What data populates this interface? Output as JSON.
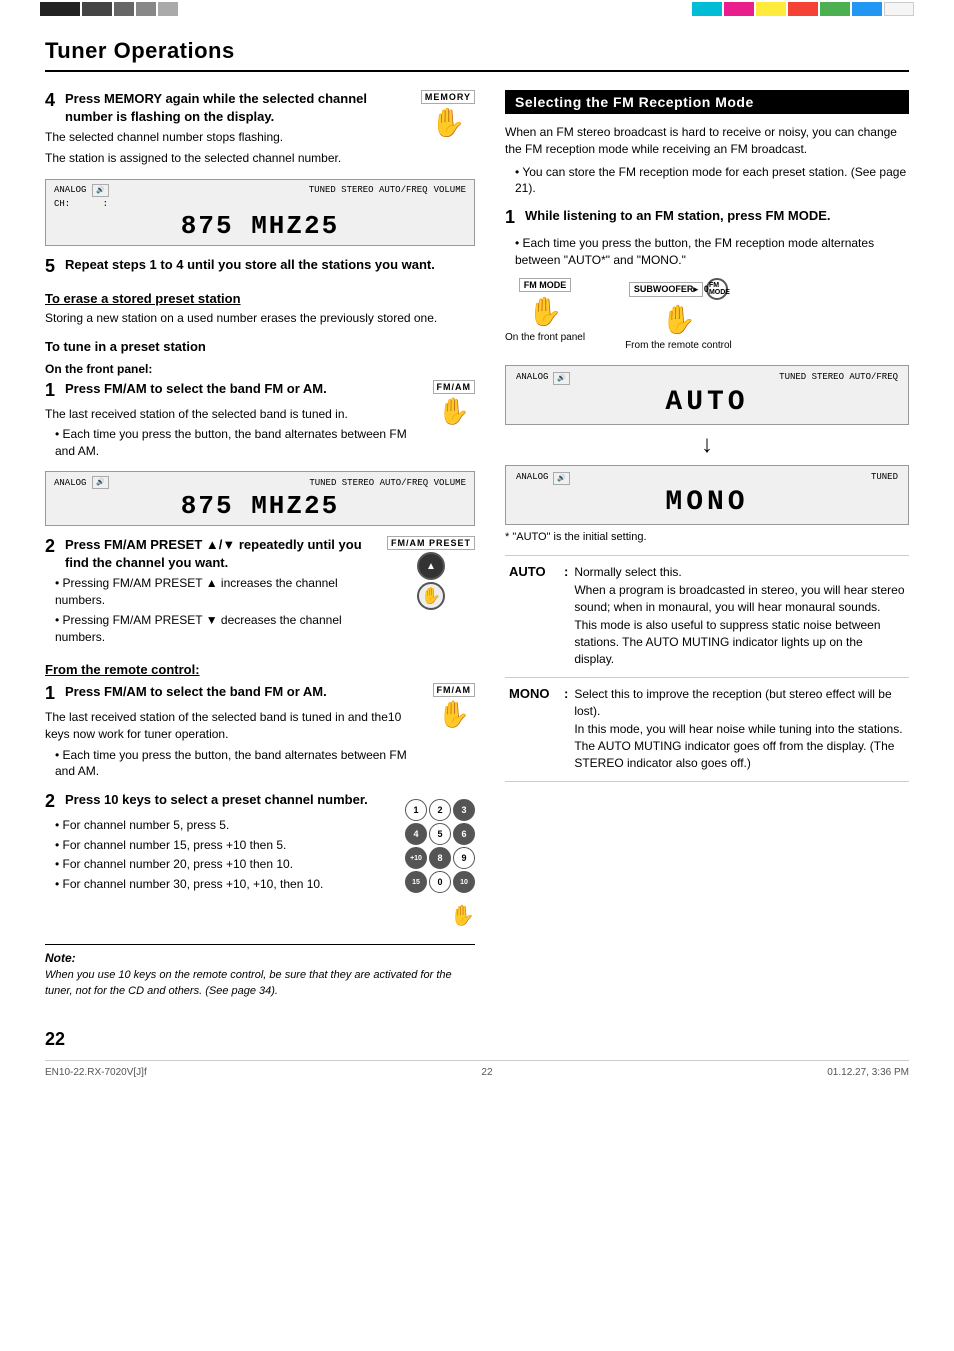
{
  "page": {
    "title": "Tuner Operations",
    "page_number": "22",
    "footer_left": "EN10-22.RX-7020V[J]f",
    "footer_center": "22",
    "footer_right": "01.12.27, 3:36 PM"
  },
  "left_col": {
    "step4": {
      "number": "4",
      "text": "Press MEMORY again while the selected channel number is flashing on the display.",
      "sub1": "The selected channel number stops flashing.",
      "sub2": "The station is assigned to the selected channel number.",
      "display": "875 MHZ25"
    },
    "step5": {
      "number": "5",
      "text": "Repeat steps 1 to 4 until you store all the stations you want."
    },
    "erase_section": {
      "label": "To erase a stored preset station",
      "text": "Storing a new station on a used number erases the previously stored one."
    },
    "tune_section": {
      "label": "To tune in a preset station",
      "front_panel": "On the front panel:"
    },
    "step1_front": {
      "number": "1",
      "text": "Press FM/AM to select the band FM or AM.",
      "sub1": "The last received station of the selected band is tuned in.",
      "bullet1": "Each time you press the button, the band alternates between FM and AM.",
      "display": "875 MHZ25"
    },
    "step2": {
      "number": "2",
      "text": "Press FM/AM PRESET ▲/▼ repeatedly until you find the channel you want.",
      "bullet1": "Pressing FM/AM PRESET ▲ increases the channel numbers.",
      "bullet2": "Pressing FM/AM PRESET ▼ decreases the channel numbers."
    },
    "remote_section": {
      "label": "From the remote control:"
    },
    "step1_remote": {
      "number": "1",
      "text": "Press FM/AM to select the band FM or AM.",
      "sub1": "The last received station of the selected band is tuned in and the10 keys now work for tuner operation.",
      "bullet1": "Each time you press the button, the band alternates between FM and AM."
    },
    "step2_remote": {
      "number": "2",
      "text": "Press 10 keys to select a preset channel number.",
      "bullet1": "For channel number 5, press 5.",
      "bullet2": "For channel number 15, press +10 then 5.",
      "bullet3": "For channel number 20, press +10 then 10.",
      "bullet4": "For channel number 30, press +10, +10, then 10."
    },
    "note": {
      "label": "Note:",
      "text": "When you use 10 keys on the remote control, be sure that they are activated for the tuner, not for the CD and others. (See page 34)."
    }
  },
  "right_col": {
    "section_title": "Selecting the FM Reception Mode",
    "intro1": "When an FM stereo broadcast is hard to receive or noisy, you can change the FM reception mode while receiving an FM broadcast.",
    "bullet1": "You can store the FM reception mode for each preset station. (See page 21).",
    "step1": {
      "number": "1",
      "text": "While listening to an FM station, press FM MODE.",
      "bullet1": "Each time you press the button, the FM reception mode alternates between \"AUTO*\" and \"MONO.\""
    },
    "labels": {
      "front_panel": "On the front panel",
      "remote_control": "From the remote control"
    },
    "display_auto": "AUTO",
    "display_mono": "MONO",
    "asterisk_note": "* \"AUTO\" is the initial setting.",
    "auto_mode": {
      "key": "AUTO",
      "desc": "Normally select this.\nWhen a program is broadcasted in stereo, you will hear stereo sound; when in monaural, you will hear monaural sounds. This mode is also useful to suppress static noise between stations. The AUTO MUTING indicator lights up on the display."
    },
    "mono_mode": {
      "key": "MONO",
      "desc": "Select this to improve the reception (but stereo effect will be lost).\nIn this mode, you will hear noise while tuning into the stations. The AUTO MUTING indicator goes off from the display. (The STEREO indicator also goes off.)"
    }
  },
  "icons": {
    "memory_icon": "✋",
    "fm_am_icon": "✋",
    "fm_preset_icon": "☜",
    "crosshair": "⊕",
    "hand": "☞",
    "arrow_down": "↓",
    "keypad_keys": [
      "1",
      "2",
      "3",
      "4",
      "5",
      "6",
      "+10",
      "8",
      "9",
      "15",
      "0",
      "10"
    ]
  }
}
